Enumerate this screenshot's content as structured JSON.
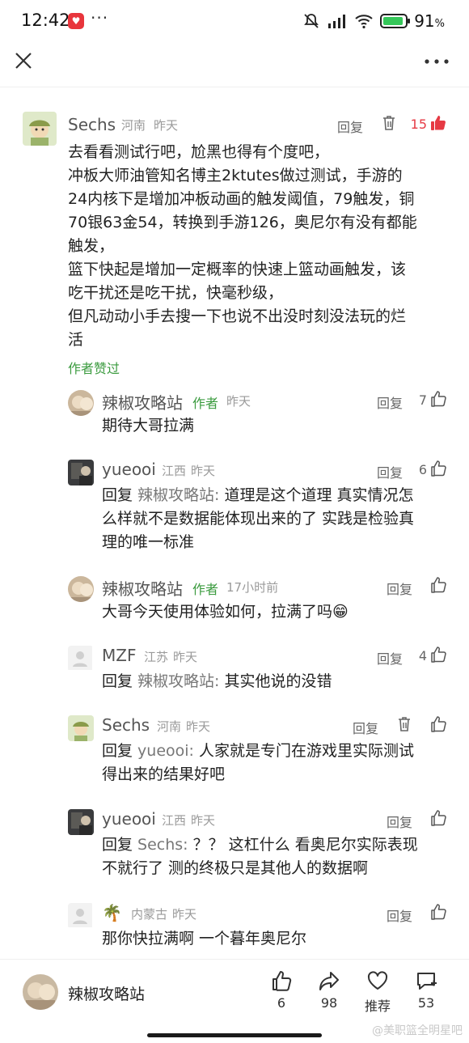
{
  "status_bar": {
    "time": "12:42",
    "more": "···",
    "battery_pct": "91",
    "battery_unit": "%",
    "battery_level": 0.91
  },
  "top_bar": {
    "close_icon": "close-icon",
    "more_icon": "more-icon"
  },
  "main_comment": {
    "user": "Sechs",
    "location": "河南",
    "time": "昨天",
    "reply": "回复",
    "likes": "15",
    "text_lines": [
      "去看看测试行吧，尬黑也得有个度吧，",
      "冲板大师油管知名博主2ktutes做过测试，手游的",
      "24内核下是增加冲板动画的触发阈值，79触发，铜",
      "70银63金54，转换到手游126，奥尼尔有没有都能",
      "触发，",
      "篮下快起是增加一定概率的快速上篮动画触发，该",
      "吃干扰还是吃干扰，快毫秒级，",
      "但凡动动小手去搜一下也说不出没时刻没法玩的烂",
      "活"
    ],
    "author_liked": "作者赞过"
  },
  "replies": [
    {
      "user": "辣椒攻略站",
      "tag": "作者",
      "location": "",
      "time": "昨天",
      "reply": "回复",
      "likes": "7",
      "prefix": "",
      "target": "",
      "lines": [
        "期待大哥拉满"
      ]
    },
    {
      "user": "yueooi",
      "tag": "",
      "location": "江西",
      "time": "昨天",
      "reply": "回复",
      "likes": "6",
      "prefix": "回复 ",
      "target": "辣椒攻略站: ",
      "lines": [
        "道理是这个道理 真实情况怎",
        "么样就不是数据能体现出来的了 实践是检验真",
        "理的唯一标准"
      ]
    },
    {
      "user": "辣椒攻略站",
      "tag": "作者",
      "location": "",
      "time": "17小时前",
      "reply": "回复",
      "likes": "",
      "prefix": "",
      "target": "",
      "lines": [
        "大哥今天使用体验如何，拉满了吗😁"
      ]
    },
    {
      "user": "MZF",
      "tag": "",
      "location": "江苏",
      "time": "昨天",
      "reply": "回复",
      "likes": "4",
      "prefix": "回复 ",
      "target": "辣椒攻略站: ",
      "lines": [
        "其实他说的没错"
      ]
    },
    {
      "user": "Sechs",
      "tag": "",
      "location": "河南",
      "time": "昨天",
      "reply": "回复",
      "likes": "",
      "prefix": "回复 ",
      "target": "yueooi: ",
      "lines": [
        "人家就是专门在游戏里实际测试",
        "得出来的结果好吧"
      ]
    },
    {
      "user": "yueooi",
      "tag": "",
      "location": "江西",
      "time": "昨天",
      "reply": "回复",
      "likes": "",
      "prefix": "回复 ",
      "target": "Sechs: ",
      "lines": [
        "？？ 这杠什么 看奥尼尔实际表现",
        "不就行了 测的终极只是其他人的数据啊"
      ]
    },
    {
      "user": "🌴",
      "tag": "",
      "location": "内蒙古",
      "time": "昨天",
      "reply": "回复",
      "likes": "",
      "prefix": "",
      "target": "",
      "lines": [
        "那你快拉满啊  一个暮年奥尼尔"
      ]
    }
  ],
  "bottom_bar": {
    "author": "辣椒攻略站",
    "like_count": "6",
    "share_count": "98",
    "recommend_label": "推荐",
    "comment_count": "53"
  },
  "watermark": "@美职篮全明星吧"
}
